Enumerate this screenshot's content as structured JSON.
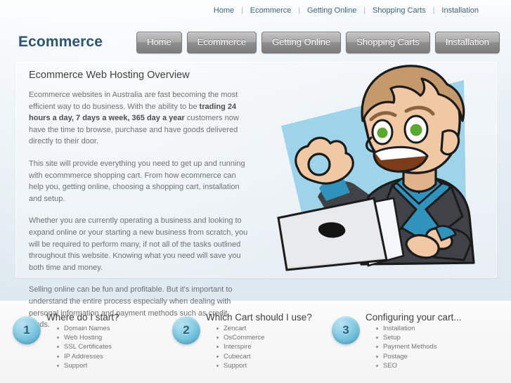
{
  "topnav": {
    "items": [
      {
        "label": "Home"
      },
      {
        "label": "Ecommerce"
      },
      {
        "label": "Getting Online"
      },
      {
        "label": "Shopping Carts"
      },
      {
        "label": "Installation"
      }
    ],
    "separator": "|"
  },
  "logo": {
    "text": "Ecommerce"
  },
  "mainnav": {
    "items": [
      {
        "label": "Home"
      },
      {
        "label": "Ecommerce"
      },
      {
        "label": "Getting Online"
      },
      {
        "label": "Shopping Carts"
      },
      {
        "label": "Installation"
      }
    ]
  },
  "main": {
    "heading": "Ecommerce Web Hosting Overview",
    "paragraphs": [
      {
        "parts": [
          {
            "text": "Ecommerce websites in Australia are fast becoming the most efficient way to do business. With the ability to be ",
            "bold": false
          },
          {
            "text": "trading 24 hours a day, 7 days a week, 365 day a year",
            "bold": true
          },
          {
            "text": " customers now have the time to browse, purchase and have goods delivered directly to their door.",
            "bold": false
          }
        ]
      },
      {
        "parts": [
          {
            "text": "This site will provide everything you need to get up and running with ecommmerce shopping cart. From how ecommerce can help you, getting online, choosing a shopping cart, installation and setup.",
            "bold": false
          }
        ]
      },
      {
        "parts": [
          {
            "text": "Whether you are currently operating a business and looking to expand online or your starting a new business from scratch, you will be required to perform many, if not all of the tasks outlined throughout this website. Knowing what you need will save you both time and money.",
            "bold": false
          }
        ]
      },
      {
        "parts": [
          {
            "text": "Selling online can be fun and profitable. But it's important to understand the entire process especially when dealing with personal information and payment methods such as credit cards.",
            "bold": false
          }
        ]
      }
    ],
    "illustration": {
      "name": "businessman-with-laptop-ok-gesture-illustration",
      "backdrop_color": "#9ed4ea",
      "skin_color": "#f0c9a4",
      "hair_color": "#c49a6c",
      "suit_color": "#3f4347",
      "shirt_color": "#2f93bb",
      "laptop_color": "#e9eaec",
      "eye_color": "#5aa832"
    }
  },
  "columns": [
    {
      "number": "1",
      "heading": "Where do I start?",
      "items": [
        "Domain Names",
        "Web Hosting",
        "SSL Certificates",
        "IP Addresses",
        "Support"
      ]
    },
    {
      "number": "2",
      "heading": "Which Cart should I use?",
      "items": [
        "Zencart",
        "OsCommerce",
        "Interspire",
        "Cubecart",
        "Support"
      ]
    },
    {
      "number": "3",
      "heading": "Configuring your cart...",
      "items": [
        "Installation",
        "Setup",
        "Payment Methods",
        "Postage",
        "SEO"
      ]
    }
  ],
  "colors": {
    "logo_blue": "#2d5570",
    "topnav_link": "#3f6178",
    "badge_blue": "#6fc0db",
    "badge_number": "#2b5f78",
    "nav_button_top": "#c2c2c2",
    "nav_button_bottom": "#7c7c7c",
    "body_text": "#6d7173"
  }
}
